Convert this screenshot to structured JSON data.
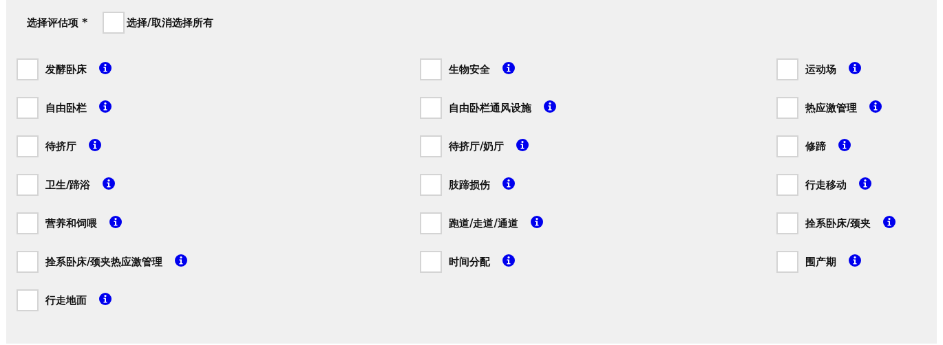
{
  "header": {
    "label": "选择评估项 *",
    "select_all": {
      "label": "选择/取消选择所有",
      "checked": false
    }
  },
  "items": [
    {
      "label": "发酵卧床",
      "checked": false
    },
    {
      "label": "生物安全",
      "checked": false
    },
    {
      "label": "运动场",
      "checked": false
    },
    {
      "label": "自由卧栏",
      "checked": false
    },
    {
      "label": "自由卧栏通风设施",
      "checked": false
    },
    {
      "label": "热应激管理",
      "checked": false
    },
    {
      "label": "待挤厅",
      "checked": false
    },
    {
      "label": "待挤厅/奶厅",
      "checked": false
    },
    {
      "label": "修蹄",
      "checked": false
    },
    {
      "label": "卫生/蹄浴",
      "checked": false
    },
    {
      "label": "肢蹄损伤",
      "checked": false
    },
    {
      "label": "行走移动",
      "checked": false
    },
    {
      "label": "营养和饲喂",
      "checked": false
    },
    {
      "label": "跑道/走道/通道",
      "checked": false
    },
    {
      "label": "拴系卧床/颈夹",
      "checked": false
    },
    {
      "label": "拴系卧床/颈夹热应激管理",
      "checked": false
    },
    {
      "label": "时间分配",
      "checked": false
    },
    {
      "label": "围产期",
      "checked": false
    },
    {
      "label": "行走地面",
      "checked": false
    }
  ]
}
